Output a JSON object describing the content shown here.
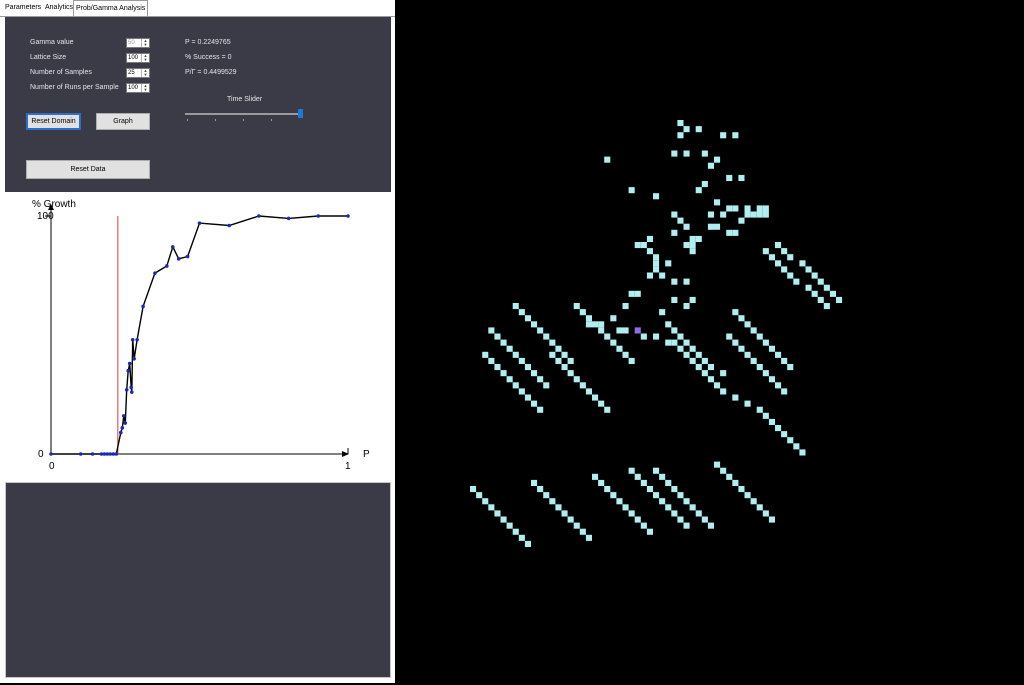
{
  "tabs": [
    "Parameters",
    "Analytics",
    "Prob/Gamma Analysis"
  ],
  "controls": {
    "gamma": {
      "label": "Gamma value",
      "value": "50"
    },
    "lattice": {
      "label": "Lattice Size",
      "value": "100"
    },
    "samples": {
      "label": "Number of Samples",
      "value": "25"
    },
    "runs": {
      "label": "Number of Runs per Sample",
      "value": "100"
    }
  },
  "readouts": {
    "p": "P = 0.2249765",
    "success": "% Success = 0",
    "ratio": "P/Γ = 0.4499529"
  },
  "slider": {
    "label": "Time Slider",
    "value_fraction": 1.0
  },
  "buttons": {
    "reset_domain": "Reset Domain",
    "graph": "Graph",
    "reset_data": "Reset Data"
  },
  "chart_data": {
    "type": "line",
    "title": "% Growth",
    "xlabel": "P",
    "ylabel": "% Growth",
    "xlim": [
      0,
      1
    ],
    "ylim": [
      0,
      100
    ],
    "x_ticks": [
      "0",
      "1"
    ],
    "y_ticks": [
      "0",
      "100"
    ],
    "threshold_x": 0.225,
    "series": [
      {
        "points": [
          [
            0.0,
            0
          ],
          [
            0.1,
            0
          ],
          [
            0.14,
            0
          ],
          [
            0.17,
            0
          ],
          [
            0.18,
            0
          ],
          [
            0.19,
            0
          ],
          [
            0.2,
            0
          ],
          [
            0.21,
            0
          ],
          [
            0.22,
            0
          ],
          [
            0.235,
            9
          ],
          [
            0.24,
            11
          ],
          [
            0.245,
            16
          ],
          [
            0.25,
            13
          ],
          [
            0.255,
            27
          ],
          [
            0.26,
            35
          ],
          [
            0.265,
            38
          ],
          [
            0.27,
            28
          ],
          [
            0.272,
            26
          ],
          [
            0.275,
            48
          ],
          [
            0.28,
            40
          ],
          [
            0.29,
            48
          ],
          [
            0.31,
            62
          ],
          [
            0.35,
            76
          ],
          [
            0.39,
            79
          ],
          [
            0.41,
            87
          ],
          [
            0.43,
            82
          ],
          [
            0.46,
            83
          ],
          [
            0.5,
            97
          ],
          [
            0.6,
            96
          ],
          [
            0.7,
            100
          ],
          [
            0.8,
            99
          ],
          [
            0.9,
            100
          ],
          [
            1.0,
            100
          ]
        ]
      }
    ]
  },
  "simulation": {
    "cell_color": "#b0eef0",
    "seed_color": "#8b6fe0",
    "grid_origin_screen": [
      470,
      120
    ],
    "cell_size": 6.1,
    "seed": [
      27,
      34
    ],
    "cells": [
      [
        34,
        0
      ],
      [
        35,
        1
      ],
      [
        37,
        1
      ],
      [
        41,
        2
      ],
      [
        43,
        2
      ],
      [
        34,
        2
      ],
      [
        33,
        5
      ],
      [
        35,
        5
      ],
      [
        38,
        5
      ],
      [
        40,
        6
      ],
      [
        39,
        7
      ],
      [
        42,
        9
      ],
      [
        44,
        9
      ],
      [
        22,
        6
      ],
      [
        26,
        11
      ],
      [
        30,
        12
      ],
      [
        37,
        11
      ],
      [
        38,
        10
      ],
      [
        40,
        13
      ],
      [
        42,
        14
      ],
      [
        43,
        14
      ],
      [
        45,
        14
      ],
      [
        47,
        14
      ],
      [
        48,
        14
      ],
      [
        41,
        15
      ],
      [
        39,
        15
      ],
      [
        33,
        15
      ],
      [
        34,
        16
      ],
      [
        35,
        17
      ],
      [
        36,
        19
      ],
      [
        36,
        20
      ],
      [
        36,
        21
      ],
      [
        35,
        20
      ],
      [
        33,
        18
      ],
      [
        29,
        19
      ],
      [
        27,
        20
      ],
      [
        28,
        20
      ],
      [
        30,
        23
      ],
      [
        32,
        23
      ],
      [
        37,
        19
      ],
      [
        39,
        17
      ],
      [
        40,
        17
      ],
      [
        42,
        18
      ],
      [
        43,
        18
      ],
      [
        44,
        16
      ],
      [
        45,
        15
      ],
      [
        46,
        15
      ],
      [
        47,
        15
      ],
      [
        48,
        15
      ],
      [
        29,
        21
      ],
      [
        30,
        22
      ],
      [
        30,
        24
      ],
      [
        29,
        25
      ],
      [
        31,
        25
      ],
      [
        33,
        26
      ],
      [
        35,
        26
      ],
      [
        36,
        29
      ],
      [
        35,
        30
      ],
      [
        33,
        29
      ],
      [
        26,
        28
      ],
      [
        27,
        28
      ],
      [
        25,
        30
      ],
      [
        23,
        32
      ],
      [
        21,
        33
      ],
      [
        19,
        33
      ],
      [
        24,
        34
      ],
      [
        25,
        34
      ],
      [
        28,
        35
      ],
      [
        30,
        35
      ],
      [
        32,
        36
      ],
      [
        33,
        36
      ],
      [
        34,
        37
      ],
      [
        35,
        38
      ],
      [
        36,
        39
      ],
      [
        37,
        40
      ],
      [
        38,
        41
      ],
      [
        39,
        42
      ],
      [
        40,
        43
      ],
      [
        41,
        44
      ],
      [
        43,
        45
      ],
      [
        45,
        46
      ],
      [
        47,
        47
      ],
      [
        48,
        48
      ],
      [
        49,
        49
      ],
      [
        50,
        50
      ],
      [
        51,
        51
      ],
      [
        52,
        52
      ],
      [
        53,
        53
      ],
      [
        54,
        54
      ],
      [
        31,
        31
      ],
      [
        32,
        33
      ],
      [
        33,
        34
      ],
      [
        34,
        35
      ],
      [
        35,
        36
      ],
      [
        36,
        37
      ],
      [
        37,
        38
      ],
      [
        38,
        39
      ],
      [
        39,
        40
      ],
      [
        41,
        41
      ],
      [
        50,
        20
      ],
      [
        51,
        21
      ],
      [
        52,
        22
      ],
      [
        54,
        23
      ],
      [
        55,
        24
      ],
      [
        56,
        25
      ],
      [
        57,
        26
      ],
      [
        58,
        27
      ],
      [
        59,
        28
      ],
      [
        60,
        29
      ],
      [
        48,
        21
      ],
      [
        49,
        22
      ],
      [
        50,
        23
      ],
      [
        51,
        24
      ],
      [
        52,
        25
      ],
      [
        53,
        26
      ],
      [
        55,
        27
      ],
      [
        56,
        28
      ],
      [
        57,
        29
      ],
      [
        58,
        30
      ],
      [
        43,
        31
      ],
      [
        44,
        32
      ],
      [
        45,
        33
      ],
      [
        46,
        34
      ],
      [
        47,
        35
      ],
      [
        48,
        36
      ],
      [
        49,
        37
      ],
      [
        50,
        38
      ],
      [
        51,
        39
      ],
      [
        52,
        40
      ],
      [
        42,
        35
      ],
      [
        43,
        36
      ],
      [
        44,
        37
      ],
      [
        45,
        38
      ],
      [
        46,
        39
      ],
      [
        47,
        40
      ],
      [
        48,
        41
      ],
      [
        49,
        42
      ],
      [
        50,
        43
      ],
      [
        51,
        44
      ],
      [
        3,
        34
      ],
      [
        4,
        35
      ],
      [
        5,
        36
      ],
      [
        6,
        37
      ],
      [
        7,
        38
      ],
      [
        8,
        39
      ],
      [
        9,
        40
      ],
      [
        10,
        41
      ],
      [
        11,
        42
      ],
      [
        12,
        43
      ],
      [
        2,
        38
      ],
      [
        3,
        39
      ],
      [
        4,
        40
      ],
      [
        5,
        41
      ],
      [
        6,
        42
      ],
      [
        7,
        43
      ],
      [
        8,
        44
      ],
      [
        9,
        45
      ],
      [
        10,
        46
      ],
      [
        11,
        47
      ],
      [
        13,
        38
      ],
      [
        14,
        39
      ],
      [
        15,
        40
      ],
      [
        16,
        41
      ],
      [
        17,
        42
      ],
      [
        18,
        43
      ],
      [
        19,
        44
      ],
      [
        20,
        45
      ],
      [
        21,
        46
      ],
      [
        22,
        47
      ],
      [
        7,
        30
      ],
      [
        8,
        31
      ],
      [
        9,
        32
      ],
      [
        10,
        33
      ],
      [
        11,
        34
      ],
      [
        12,
        35
      ],
      [
        13,
        36
      ],
      [
        14,
        37
      ],
      [
        15,
        38
      ],
      [
        16,
        39
      ],
      [
        17,
        30
      ],
      [
        18,
        31
      ],
      [
        19,
        32
      ],
      [
        20,
        33
      ],
      [
        21,
        34
      ],
      [
        22,
        35
      ],
      [
        23,
        36
      ],
      [
        24,
        37
      ],
      [
        25,
        38
      ],
      [
        26,
        39
      ],
      [
        0,
        60
      ],
      [
        1,
        61
      ],
      [
        2,
        62
      ],
      [
        3,
        63
      ],
      [
        4,
        64
      ],
      [
        5,
        65
      ],
      [
        6,
        66
      ],
      [
        7,
        67
      ],
      [
        8,
        68
      ],
      [
        9,
        69
      ],
      [
        10,
        59
      ],
      [
        11,
        60
      ],
      [
        12,
        61
      ],
      [
        13,
        62
      ],
      [
        14,
        63
      ],
      [
        15,
        64
      ],
      [
        16,
        65
      ],
      [
        17,
        66
      ],
      [
        18,
        67
      ],
      [
        19,
        68
      ],
      [
        20,
        58
      ],
      [
        21,
        59
      ],
      [
        22,
        60
      ],
      [
        23,
        61
      ],
      [
        24,
        62
      ],
      [
        25,
        63
      ],
      [
        26,
        64
      ],
      [
        27,
        65
      ],
      [
        28,
        66
      ],
      [
        29,
        67
      ],
      [
        30,
        57
      ],
      [
        31,
        58
      ],
      [
        32,
        59
      ],
      [
        33,
        60
      ],
      [
        34,
        61
      ],
      [
        35,
        62
      ],
      [
        36,
        63
      ],
      [
        37,
        64
      ],
      [
        38,
        65
      ],
      [
        39,
        66
      ],
      [
        40,
        56
      ],
      [
        41,
        57
      ],
      [
        42,
        58
      ],
      [
        43,
        59
      ],
      [
        44,
        60
      ],
      [
        45,
        61
      ],
      [
        46,
        62
      ],
      [
        47,
        63
      ],
      [
        48,
        64
      ],
      [
        49,
        65
      ],
      [
        26,
        57
      ],
      [
        27,
        58
      ],
      [
        28,
        59
      ],
      [
        29,
        60
      ],
      [
        30,
        61
      ],
      [
        31,
        62
      ],
      [
        32,
        63
      ],
      [
        33,
        64
      ],
      [
        34,
        65
      ],
      [
        35,
        66
      ]
    ]
  }
}
